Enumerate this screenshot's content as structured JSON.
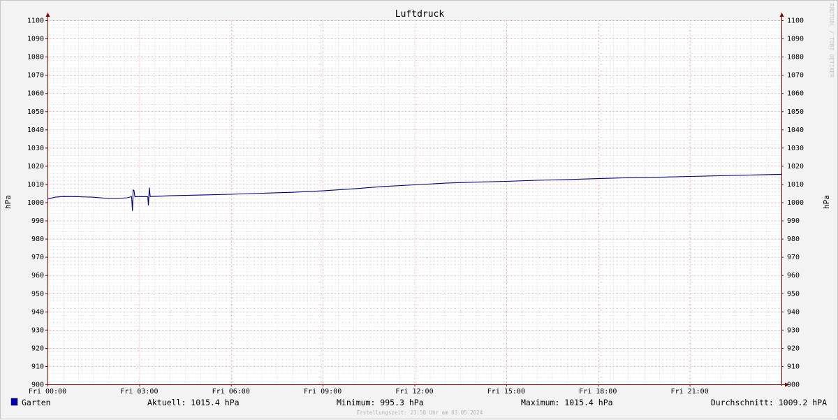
{
  "chart_data": {
    "type": "line",
    "title": "Luftdruck",
    "ylabel": "hPa",
    "ylim": [
      900,
      1100
    ],
    "yticks": [
      900,
      910,
      920,
      930,
      940,
      950,
      960,
      970,
      980,
      990,
      1000,
      1010,
      1020,
      1030,
      1040,
      1050,
      1060,
      1070,
      1080,
      1090,
      1100
    ],
    "x_hours": [
      0,
      3,
      6,
      9,
      12,
      15,
      18,
      21
    ],
    "xlim_hours": [
      0,
      24
    ],
    "xtick_labels": [
      "Fri 00:00",
      "Fri 03:00",
      "Fri 06:00",
      "Fri 09:00",
      "Fri 12:00",
      "Fri 15:00",
      "Fri 18:00",
      "Fri 21:00"
    ],
    "grid": true,
    "series": [
      {
        "name": "Garten",
        "color": "#00007a",
        "x_hours": [
          0.0,
          0.25,
          0.5,
          1.0,
          1.5,
          2.0,
          2.3,
          2.6,
          2.75,
          2.78,
          2.8,
          2.83,
          2.86,
          2.9,
          3.0,
          3.2,
          3.28,
          3.3,
          3.33,
          3.36,
          3.4,
          3.6,
          4.0,
          5.0,
          6.0,
          7.0,
          8.0,
          9.0,
          10.0,
          11.0,
          12.0,
          13.0,
          14.0,
          15.0,
          16.0,
          17.0,
          18.0,
          19.0,
          20.0,
          21.0,
          22.0,
          23.0,
          24.0
        ],
        "values": [
          1001.8,
          1002.8,
          1003.2,
          1003.1,
          1002.8,
          1002.1,
          1002.1,
          1002.5,
          1003.1,
          995.3,
          1006.8,
          1006.5,
          1003.0,
          1003.1,
          1003.1,
          1003.1,
          1003.1,
          998.3,
          1008.1,
          1003.2,
          1003.2,
          1003.3,
          1003.6,
          1004.0,
          1004.4,
          1005.0,
          1005.5,
          1006.3,
          1007.4,
          1008.7,
          1009.6,
          1010.5,
          1011.1,
          1011.5,
          1012.1,
          1012.5,
          1013.0,
          1013.5,
          1013.8,
          1014.2,
          1014.6,
          1015.0,
          1015.4
        ]
      }
    ]
  },
  "legend": {
    "series_name": "Garten",
    "swatch_color": "#0000aa",
    "aktuell": "Aktuell: 1015.4 hPa",
    "minimum": "Minimum: 995.3 hPa",
    "maximum": "Maximum: 1015.4 hPa",
    "durchschnitt": "Durchschnitt: 1009.2 hPA"
  },
  "footer": "Erstellungszeit: 23:58 Uhr am 03.05.2024",
  "watermark": "RRDTOOL / TOBI OETIKER",
  "colors": {
    "background": "#f3f3f3",
    "plot_background": "#ffffff",
    "major_grid": "#e4a0a0",
    "minor_grid": "#dcdcdc",
    "axis": "#800000"
  }
}
